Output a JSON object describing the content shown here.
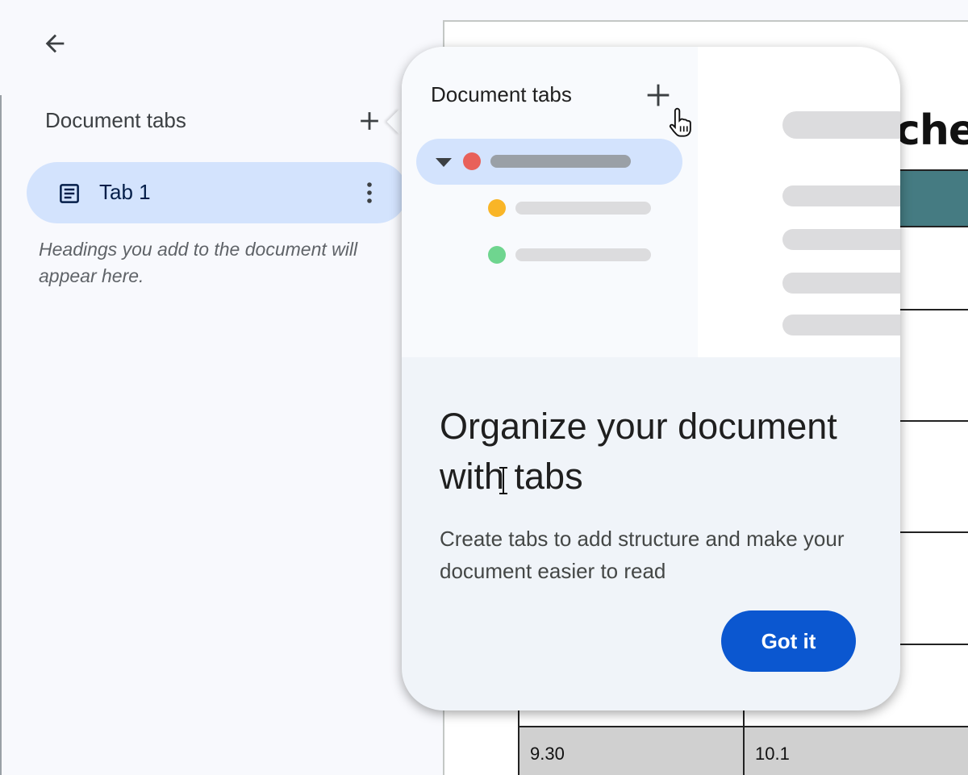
{
  "sidebar": {
    "title": "Document tabs",
    "add_icon": "plus-icon",
    "back_icon": "arrow-back-icon",
    "tab": {
      "label": "Tab 1",
      "icon": "document-icon",
      "more_icon": "more-vertical-icon"
    },
    "hint": "Headings you add to the document will appear here."
  },
  "document": {
    "heading_fragment": "che",
    "table_cells": [
      "9.30",
      "10.1"
    ],
    "band_color": "#457b82"
  },
  "popup": {
    "illustration": {
      "title": "Document tabs",
      "plus_icon": "plus-icon",
      "cursor_icon": "hand-pointer-icon",
      "dot_colors": [
        "#e8615a",
        "#f9b527",
        "#6fd58f"
      ]
    },
    "headline": "Organize your document with tabs",
    "body": "Create tabs to add structure and make your document easier to read",
    "button_label": "Got it",
    "button_color": "#0b57d0"
  }
}
